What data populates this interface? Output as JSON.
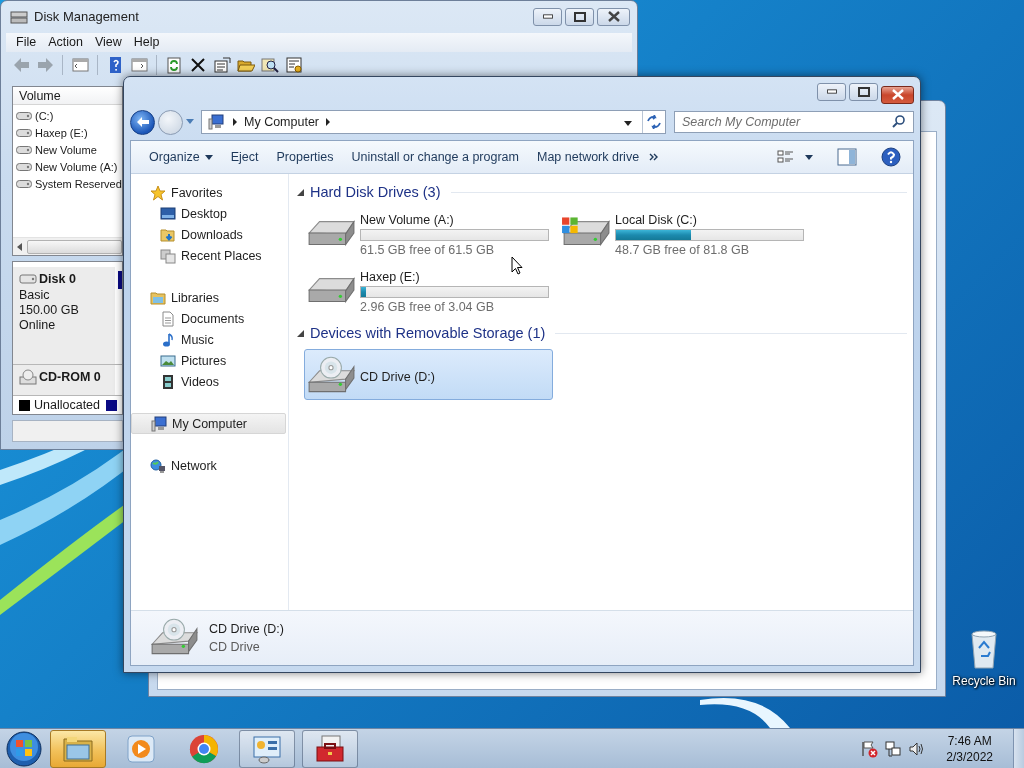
{
  "disk_management": {
    "title": "Disk Management",
    "menu": [
      "File",
      "Action",
      "View",
      "Help"
    ],
    "list_header": "Volume",
    "volumes": [
      "(C:)",
      "Haxep (E:)",
      "New Volume",
      "New Volume (A:)",
      "System Reserved"
    ],
    "disks": [
      {
        "kind": "disk",
        "name": "Disk 0",
        "details": [
          "Basic",
          "150.00 GB",
          "Online"
        ]
      },
      {
        "kind": "cdrom",
        "name": "CD-ROM 0"
      }
    ],
    "legend": [
      {
        "label": "Unallocated",
        "color": "#000000"
      },
      {
        "color": "#0a0a84"
      }
    ]
  },
  "explorer": {
    "address": {
      "crumbs": [
        "My Computer"
      ]
    },
    "search": {
      "placeholder": "Search My Computer"
    },
    "commands": [
      {
        "label": "Organize",
        "dropdown": true
      },
      {
        "label": "Eject",
        "dropdown": false
      },
      {
        "label": "Properties",
        "dropdown": false
      },
      {
        "label": "Uninstall or change a program",
        "dropdown": false
      },
      {
        "label": "Map network drive",
        "dropdown": false
      }
    ],
    "navigation": [
      {
        "label": "Favorites",
        "kind": "favorites",
        "selected": false,
        "children": [
          {
            "label": "Desktop",
            "kind": "desktop",
            "selected": false
          },
          {
            "label": "Downloads",
            "kind": "downloads",
            "selected": false
          },
          {
            "label": "Recent Places",
            "kind": "recent",
            "selected": false
          }
        ]
      },
      {
        "label": "Libraries",
        "kind": "libraries",
        "selected": false,
        "children": [
          {
            "label": "Documents",
            "kind": "documents",
            "selected": false
          },
          {
            "label": "Music",
            "kind": "music",
            "selected": false
          },
          {
            "label": "Pictures",
            "kind": "pictures",
            "selected": false
          },
          {
            "label": "Videos",
            "kind": "videos",
            "selected": false
          }
        ]
      },
      {
        "label": "My Computer",
        "kind": "computer",
        "selected": true
      },
      {
        "label": "Network",
        "kind": "network",
        "selected": false
      }
    ],
    "groups": [
      {
        "title": "Hard Disk Drives (3)",
        "expanded": true,
        "drives": [
          {
            "name": "New Volume (A:)",
            "kind": "hdd",
            "level": 0,
            "free": "61.5 GB free of 61.5 GB",
            "selected": false
          },
          {
            "name": "Local Disk (C:)",
            "kind": "system",
            "level": 0.4,
            "free": "48.7 GB free of 81.8 GB",
            "selected": false
          },
          {
            "name": "Haxep (E:)",
            "kind": "hdd",
            "level": 0.025,
            "free": "2.96 GB free of 3.04 GB",
            "selected": false
          }
        ]
      },
      {
        "title": "Devices with Removable Storage (1)",
        "expanded": true,
        "drives": [
          {
            "name": "CD Drive (D:)",
            "kind": "cd",
            "selected": true
          }
        ]
      }
    ],
    "details": {
      "kind": "cd",
      "name": "CD Drive (D:)",
      "type": "CD Drive"
    }
  },
  "desktop": {
    "icons": [
      {
        "label": "Recycle Bin",
        "kind": "recycle-bin"
      }
    ]
  },
  "taskbar": {
    "buttons": [
      {
        "kind": "explorer",
        "open": true,
        "selected": true
      },
      {
        "kind": "media-player",
        "open": false,
        "selected": false
      },
      {
        "kind": "chrome",
        "open": false,
        "selected": false
      },
      {
        "kind": "control-panel",
        "open": true,
        "selected": false
      },
      {
        "kind": "toolbox",
        "open": true,
        "selected": false
      }
    ],
    "clock": {
      "time": "7:46 AM",
      "date": "2/3/2022"
    }
  }
}
